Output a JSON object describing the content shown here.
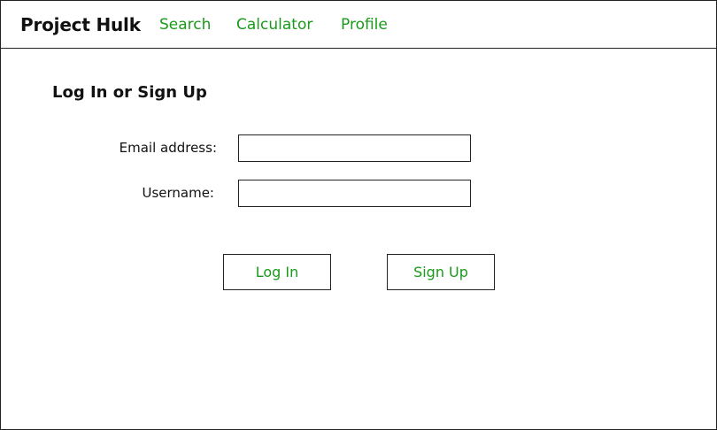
{
  "navbar": {
    "brand": "Project Hulk",
    "links": [
      {
        "label": "Search"
      },
      {
        "label": "Calculator"
      },
      {
        "label": "Profile"
      }
    ]
  },
  "main": {
    "title": "Log In or Sign Up",
    "email": {
      "label": "Email address:",
      "value": "",
      "placeholder": ""
    },
    "username": {
      "label": "Username:",
      "value": "",
      "placeholder": ""
    },
    "buttons": {
      "login": "Log In",
      "signup": "Sign Up"
    }
  },
  "colors": {
    "accent": "#1a9a1a",
    "border": "#222222",
    "text": "#111111",
    "background": "#ffffff"
  }
}
